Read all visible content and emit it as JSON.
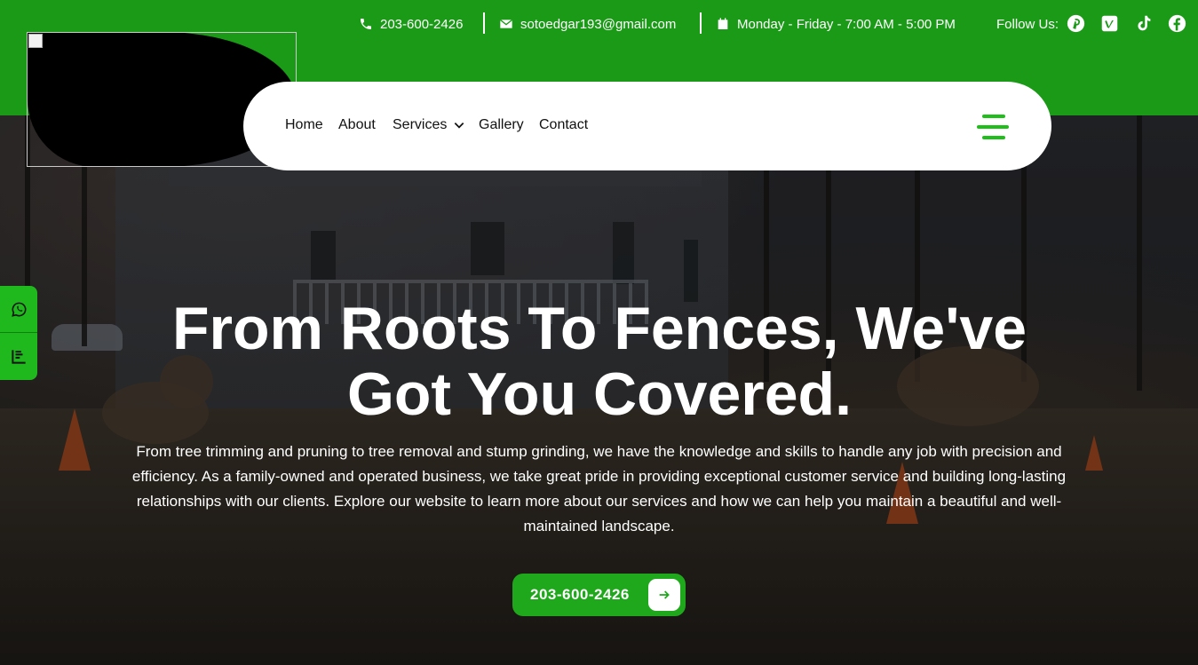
{
  "topbar": {
    "phone": "203-600-2426",
    "email": "sotoedgar193@gmail.com",
    "hours": "Monday - Friday - 7:00 AM - 5:00 PM",
    "follow_label": "Follow Us:",
    "social": [
      "pinterest-icon",
      "vimeo-icon",
      "tiktok-icon",
      "facebook-icon"
    ],
    "background_color": "#1a9a17"
  },
  "nav": {
    "items": [
      {
        "label": "Home"
      },
      {
        "label": "About"
      },
      {
        "label": "Services"
      },
      {
        "label": "Gallery"
      },
      {
        "label": "Contact"
      }
    ],
    "menu_icon": "hamburger-menu-icon",
    "accent_color": "#1fbf1a"
  },
  "floating": {
    "buttons": [
      "whatsapp-icon",
      "chart-icon"
    ],
    "color": "#1fb81d"
  },
  "hero": {
    "headline_line1": "From Roots To Fences, We've",
    "headline_line2": "Got You Covered.",
    "paragraph": "From tree trimming and pruning to tree removal and stump grinding, we have the knowledge and skills to handle any job with precision and efficiency. As a family-owned and operated business, we take great pride in providing exceptional customer service and building long-lasting relationships with our clients. Explore our website to learn more about our services and how we can help you maintain a beautiful and well-maintained landscape.",
    "cta_label": "203-600-2426",
    "cta_color": "#1fa81c"
  }
}
